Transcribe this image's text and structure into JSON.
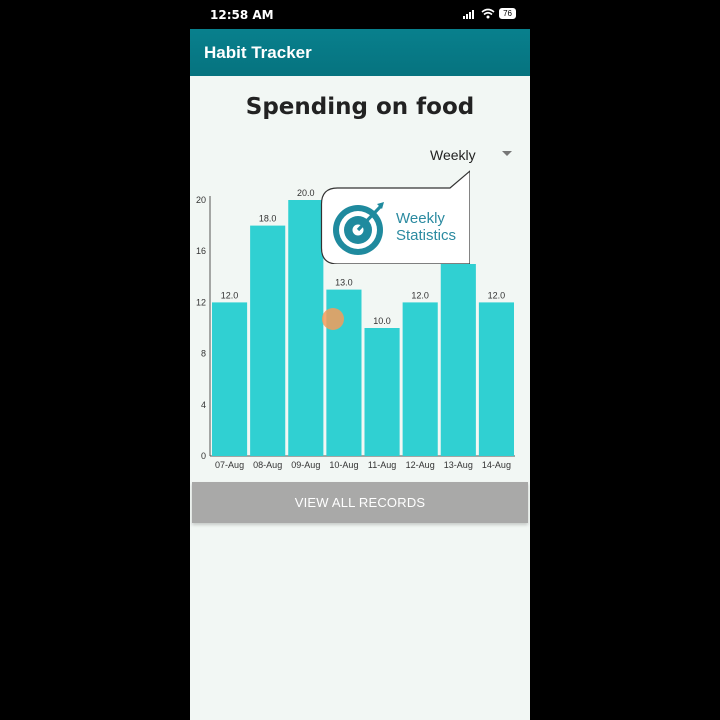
{
  "status_bar": {
    "time": "12:58 AM",
    "battery": "76"
  },
  "app": {
    "title": "Habit Tracker"
  },
  "page": {
    "title": "Spending on food"
  },
  "period_select": {
    "selected": "Weekly"
  },
  "callout": {
    "line1": "Weekly",
    "line2": "Statistics"
  },
  "colors": {
    "app_bar": "#08808d",
    "bar": "#30d0d2",
    "button": "#a9a9a8",
    "callout_icon": "#1f8a9e"
  },
  "chart_data": {
    "type": "bar",
    "categories": [
      "07-Aug",
      "08-Aug",
      "09-Aug",
      "10-Aug",
      "11-Aug",
      "12-Aug",
      "13-Aug",
      "14-Aug"
    ],
    "values": [
      12.0,
      18.0,
      20.0,
      13.0,
      10.0,
      12.0,
      15.0,
      12.0
    ],
    "value_labels": [
      "12.0",
      "18.0",
      "20.0",
      "13.0",
      "10.0",
      "12.0",
      "",
      "12.0"
    ],
    "yticks": [
      0,
      4,
      8,
      12,
      16,
      20
    ],
    "ylim": [
      0,
      20
    ],
    "grid": false,
    "legend": "none"
  },
  "actions": {
    "view_all_label": "VIEW ALL RECORDS"
  }
}
